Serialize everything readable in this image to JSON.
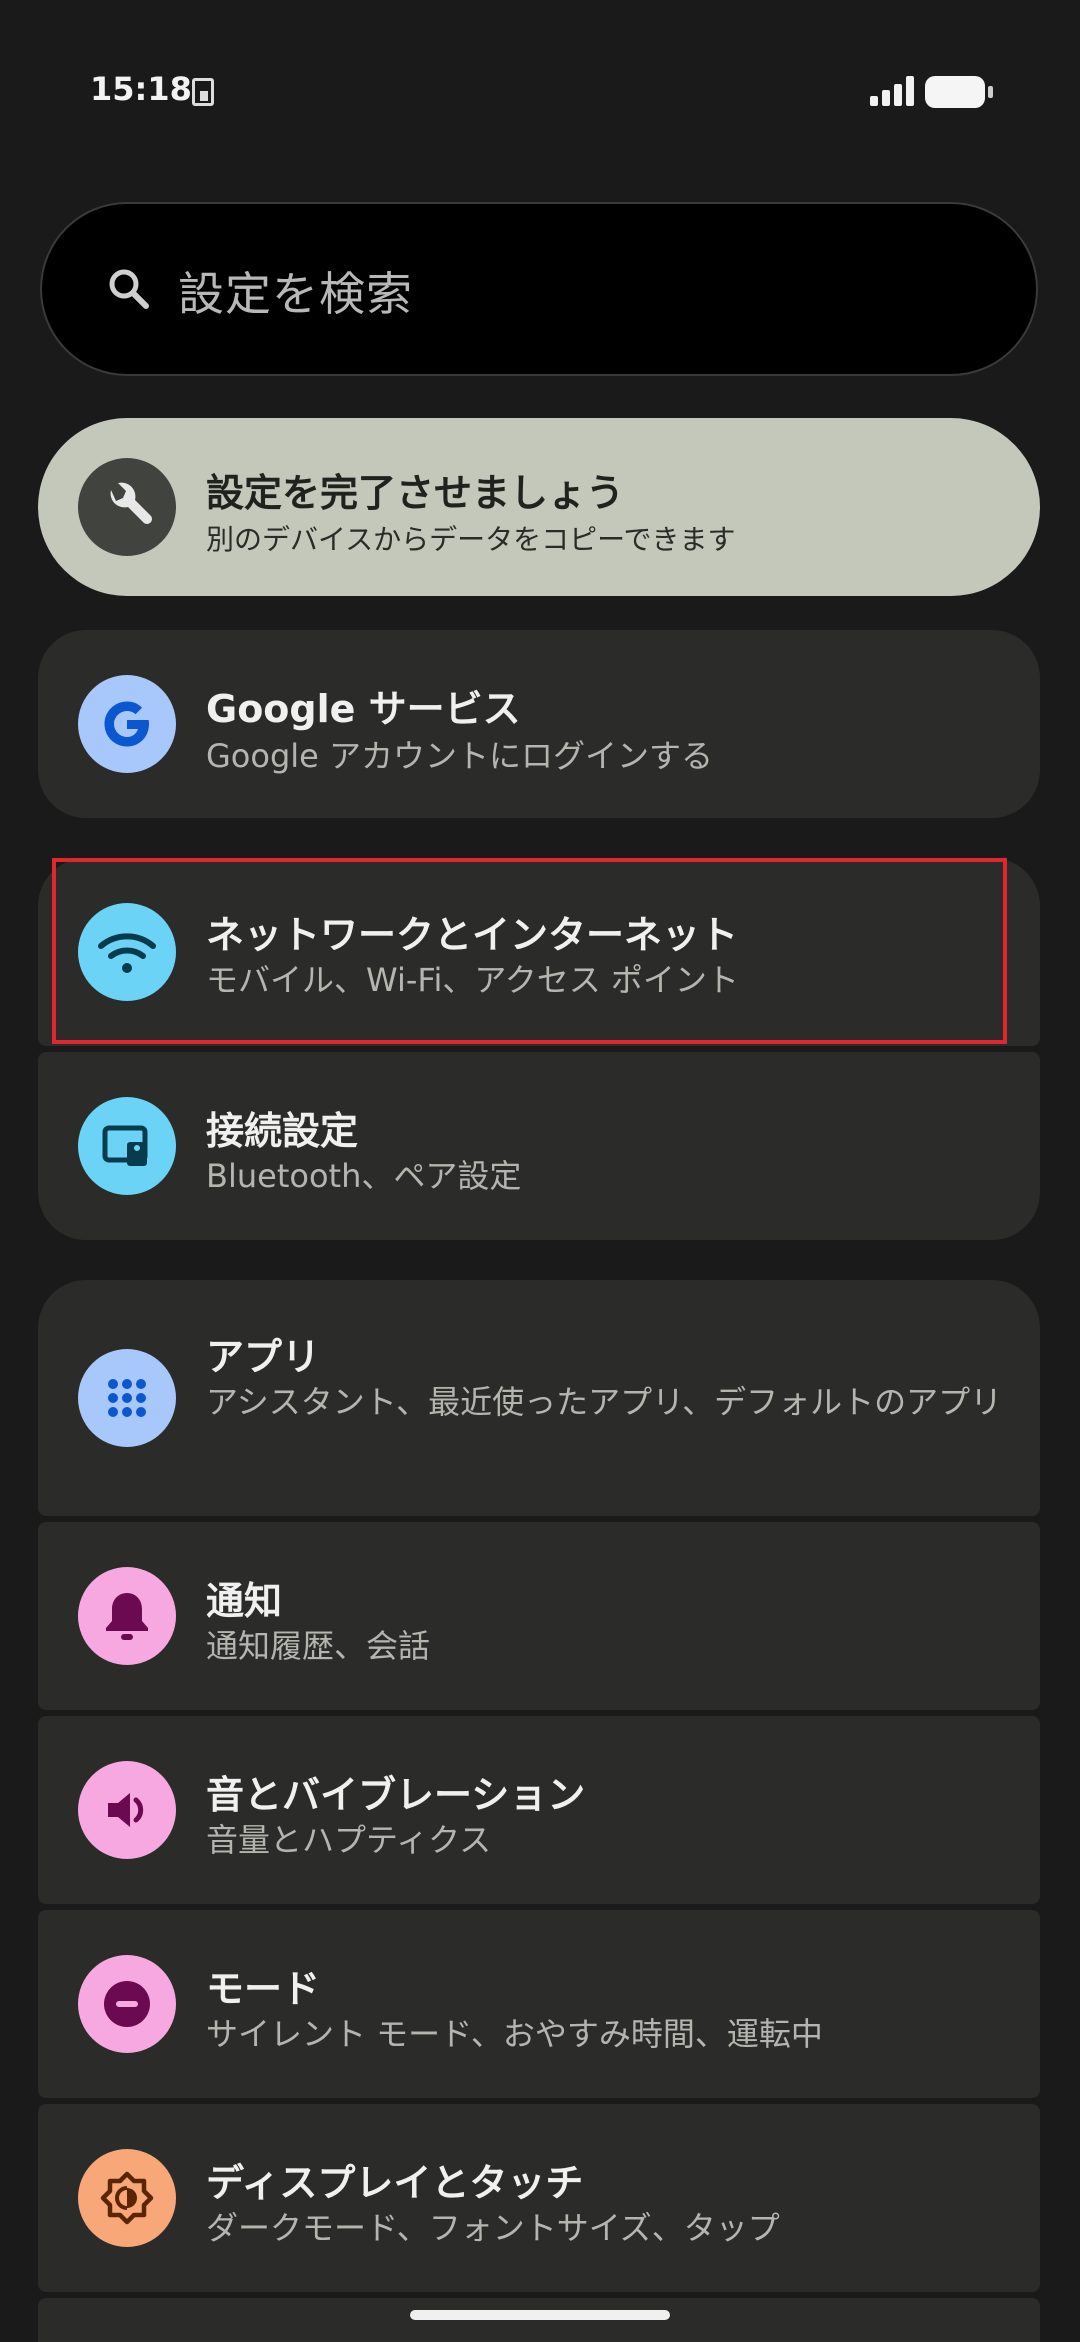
{
  "status": {
    "time": "15:18"
  },
  "search": {
    "placeholder": "設定を検索"
  },
  "setup": {
    "title": "設定を完了させましょう",
    "subtitle": "別のデバイスからデータをコピーできます"
  },
  "items": [
    {
      "title": "Google サービス",
      "subtitle": "Google アカウントにログインする",
      "icon": "google-icon",
      "color": "#a8c7fa"
    },
    {
      "title": "ネットワークとインターネット",
      "subtitle": "モバイル、Wi-Fi、アクセス ポイント",
      "icon": "wifi-icon",
      "color": "#6ad3f6"
    },
    {
      "title": "接続設定",
      "subtitle": "Bluetooth、ペア設定",
      "icon": "devices-icon",
      "color": "#6ad3f6"
    },
    {
      "title": "アプリ",
      "subtitle": "アシスタント、最近使ったアプリ、デフォルトのアプリ",
      "icon": "apps-icon",
      "color": "#a8c7fa"
    },
    {
      "title": "通知",
      "subtitle": "通知履歴、会話",
      "icon": "bell-icon",
      "color": "#f7a8e0"
    },
    {
      "title": "音とバイブレーション",
      "subtitle": "音量とハプティクス",
      "icon": "volume-icon",
      "color": "#f7a8e0"
    },
    {
      "title": "モード",
      "subtitle": "サイレント モード、おやすみ時間、運転中",
      "icon": "dnd-icon",
      "color": "#f7a8e0"
    },
    {
      "title": "ディスプレイとタッチ",
      "subtitle": "ダークモード、フォントサイズ、タップ",
      "icon": "brightness-icon",
      "color": "#f8a878"
    }
  ]
}
